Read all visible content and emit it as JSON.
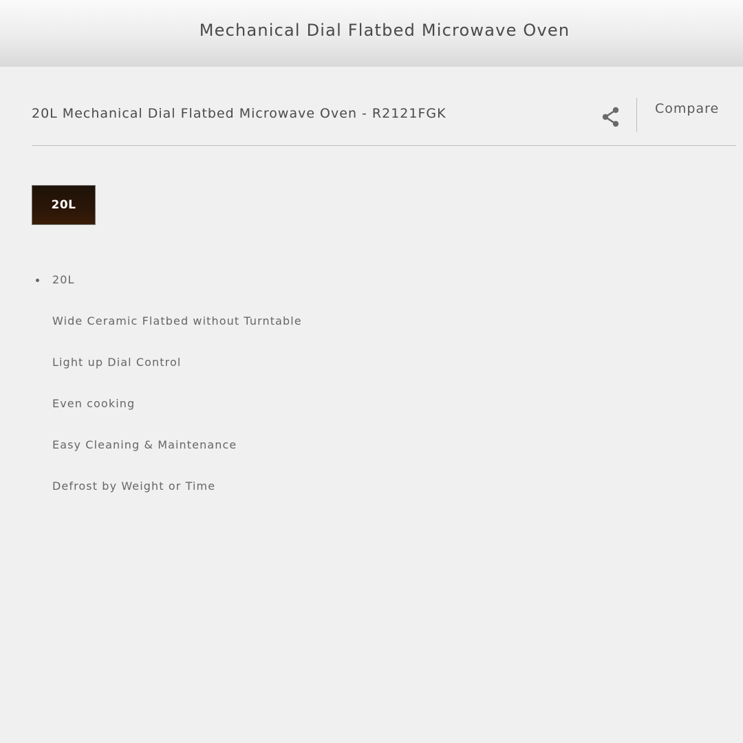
{
  "header": {
    "title": "Mechanical Dial Flatbed Microwave Oven"
  },
  "product": {
    "title": "20L Mechanical Dial Flatbed Microwave Oven - R2121FGK",
    "share_icon": "share-icon",
    "compare_label": "Compare"
  },
  "size_options": {
    "selected_label": "20L",
    "selected_color": "#2a1608"
  },
  "features": {
    "items": [
      "20L",
      "Wide Ceramic Flatbed without Turntable",
      "Light up Dial Control",
      "Even cooking",
      "Easy Cleaning & Maintenance",
      "Defrost by Weight or Time"
    ]
  }
}
